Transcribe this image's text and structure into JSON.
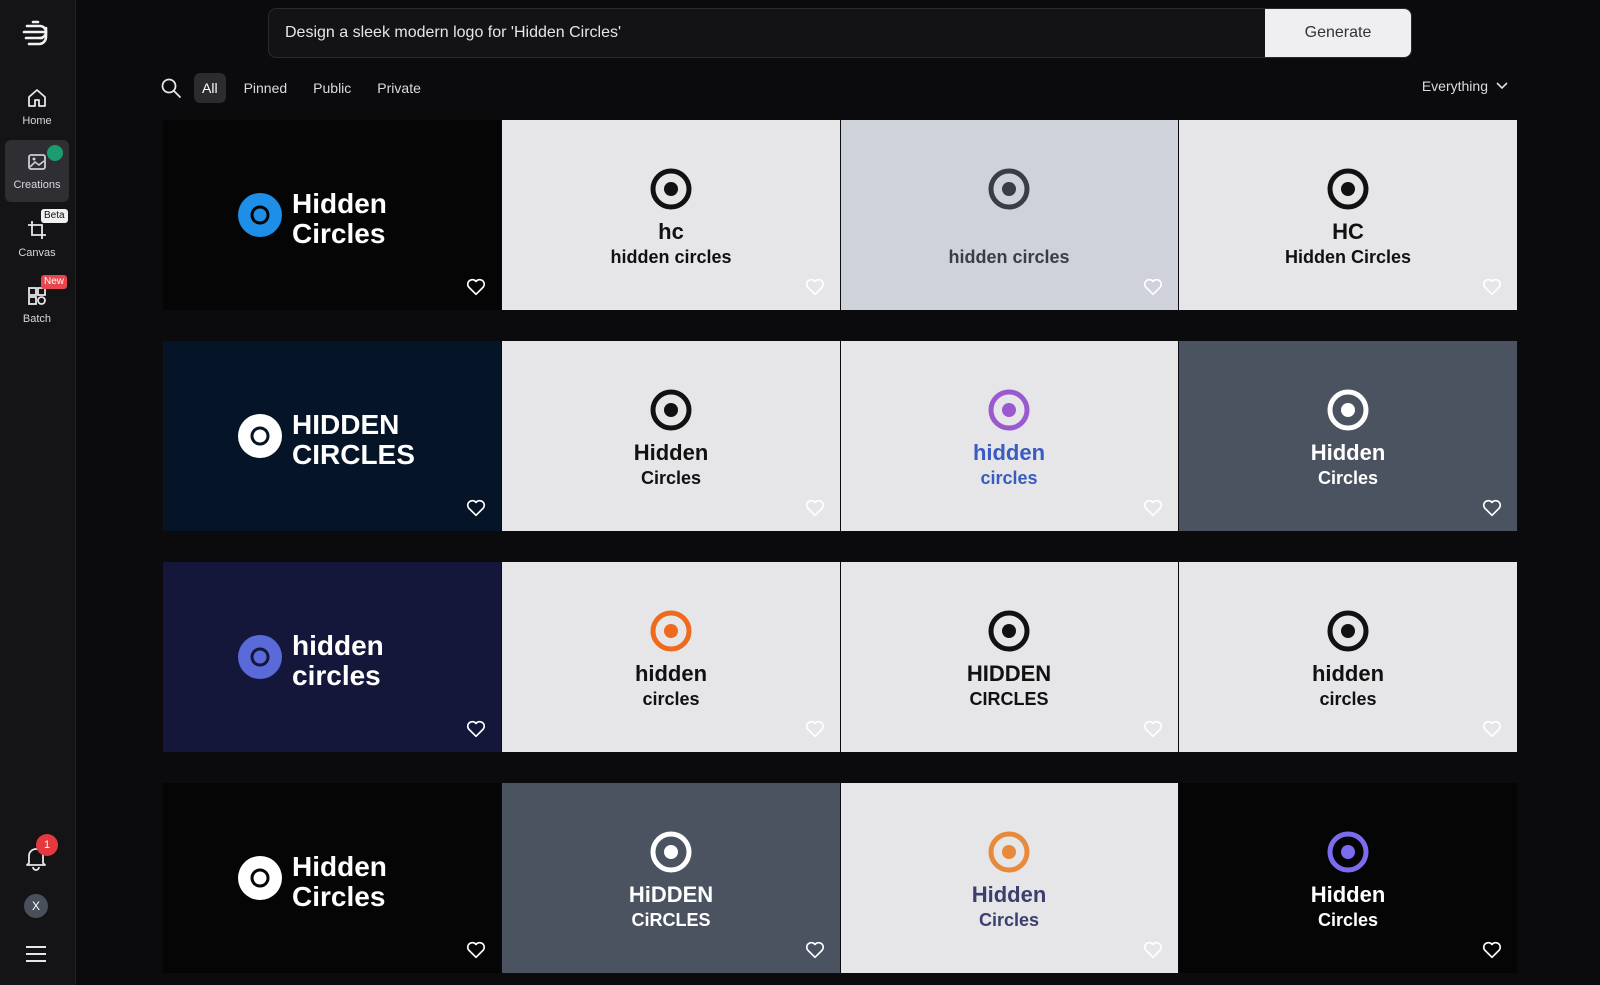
{
  "sidebar": {
    "items": [
      {
        "label": "Home"
      },
      {
        "label": "Creations"
      },
      {
        "label": "Canvas",
        "badge": "Beta"
      },
      {
        "label": "Batch",
        "badge": "New"
      }
    ],
    "notifications_count": "1",
    "avatar_initial": "X"
  },
  "prompt": {
    "value": "Design a sleek modern logo for 'Hidden Circles'",
    "generate_label": "Generate"
  },
  "filters": {
    "tabs": [
      "All",
      "Pinned",
      "Public",
      "Private"
    ],
    "active": "All",
    "scope": "Everything"
  },
  "colors": {
    "background": "#0b0b0d",
    "sidebar": "#141417",
    "accent_green": "#1a9c6e",
    "badge_red": "#e8454c"
  },
  "tiles": [
    {
      "bg": "#050505",
      "text1": "Hidden",
      "text2": "Circles",
      "fg": "#ffffff",
      "accent": "#1e8fe8",
      "heart": "#ffffff"
    },
    {
      "bg": "#e6e6e9",
      "text1": "hc",
      "text2": "hidden circles",
      "fg": "#111111",
      "accent": "#111111",
      "heart": "#ffffff"
    },
    {
      "bg": "#cfd2da",
      "text1": "",
      "text2": "hidden circles",
      "fg": "#3b3d44",
      "accent": "#3b3d44",
      "heart": "#ffffff"
    },
    {
      "bg": "#e6e6e9",
      "text1": "HC",
      "text2": "Hidden Circles",
      "fg": "#111111",
      "accent": "#111111",
      "heart": "#ffffff"
    },
    {
      "bg": "#061428",
      "text1": "HIDDEN",
      "text2": "CIRCLES",
      "fg": "#ffffff",
      "accent": "#ffffff",
      "heart": "#ffffff"
    },
    {
      "bg": "#e6e6e9",
      "text1": "Hidden",
      "text2": "Circles",
      "fg": "#111111",
      "accent": "#111111",
      "heart": "#ffffff"
    },
    {
      "bg": "#e6e6e9",
      "text1": "hidden",
      "text2": "circles",
      "fg": "#3a5bbf",
      "accent": "#9b59d0",
      "heart": "#ffffff"
    },
    {
      "bg": "#4b5260",
      "text1": "Hidden",
      "text2": "Circles",
      "fg": "#ffffff",
      "accent": "#ffffff",
      "heart": "#ffffff"
    },
    {
      "bg": "#15173a",
      "text1": "hidden",
      "text2": "circles",
      "fg": "#ffffff",
      "accent": "#5a6ad8",
      "heart": "#ffffff"
    },
    {
      "bg": "#e6e6e9",
      "text1": "hidden",
      "text2": "circles",
      "fg": "#111111",
      "accent": "#f06a1d",
      "heart": "#ffffff"
    },
    {
      "bg": "#e6e6e9",
      "text1": "HIDDEN",
      "text2": "CIRCLES",
      "fg": "#111111",
      "accent": "#111111",
      "heart": "#ffffff"
    },
    {
      "bg": "#e6e6e9",
      "text1": "hidden",
      "text2": "circles",
      "fg": "#111111",
      "accent": "#111111",
      "heart": "#ffffff"
    },
    {
      "bg": "#050505",
      "text1": "Hidden",
      "text2": "Circles",
      "fg": "#ffffff",
      "accent": "#ffffff",
      "heart": "#ffffff"
    },
    {
      "bg": "#4b5260",
      "text1": "HiDDEN",
      "text2": "CiRCLES",
      "fg": "#ffffff",
      "accent": "#ffffff",
      "heart": "#ffffff"
    },
    {
      "bg": "#e6e6e9",
      "text1": "Hidden",
      "text2": "Circles",
      "fg": "#3a3f6e",
      "accent": "#e88a3c",
      "heart": "#ffffff"
    },
    {
      "bg": "#050505",
      "text1": "Hidden",
      "text2": "Circles",
      "fg": "#ffffff",
      "accent": "#7c6cf0",
      "heart": "#ffffff"
    }
  ]
}
